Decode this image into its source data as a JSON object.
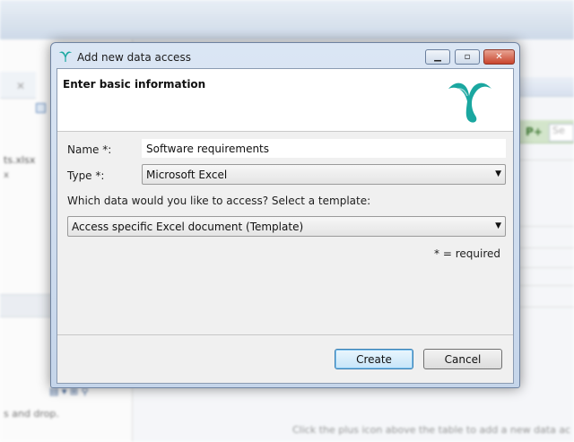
{
  "background": {
    "file_label": "ts.xlsx",
    "file_sub": "x",
    "drag_text": "s and drop.",
    "hint_text": "Click the plus icon above the table to add a new data ac",
    "search_placeholder": "Se"
  },
  "dialog": {
    "title": "Add new data access",
    "header_title": "Enter basic information",
    "name_label": "Name *:",
    "name_value": "Software requirements",
    "type_label": "Type *:",
    "type_value": "Microsoft Excel",
    "which_label": "Which data would you like to access? Select a template:",
    "template_value": "Access specific Excel document (Template)",
    "required_note": "* = required",
    "create_label": "Create",
    "cancel_label": "Cancel"
  },
  "colors": {
    "logo_teal": "#1aa7a0",
    "titlebar": "#c5d5ea",
    "close_button": "#c9452d",
    "default_button_border": "#3c7fb1"
  }
}
